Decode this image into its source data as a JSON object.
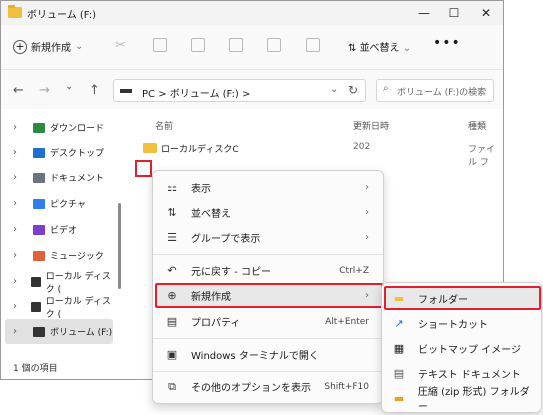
{
  "window": {
    "title": "ボリューム (F:)",
    "minimize": "—",
    "maximize": "☐",
    "close": "✕"
  },
  "toolbar": {
    "new_label": "新規作成",
    "sort_label": "並べ替え",
    "more": "•••"
  },
  "nav": {
    "back": "←",
    "forward": "→",
    "down": "⌄",
    "up": "↑"
  },
  "address": {
    "path": "PC  >  ボリューム (F:)  >",
    "chevron": "⌄",
    "refresh": "↻"
  },
  "search": {
    "placeholder": "ボリューム (F:)の検索"
  },
  "sidebar": {
    "items": [
      {
        "label": "ダウンロード",
        "color": "#2b8a3e"
      },
      {
        "label": "デスクトップ",
        "color": "#1f6fd0"
      },
      {
        "label": "ドキュメント",
        "color": "#6b7280"
      },
      {
        "label": "ピクチャ",
        "color": "#2f80ed"
      },
      {
        "label": "ビデオ",
        "color": "#7b3fd0"
      },
      {
        "label": "ミュージック",
        "color": "#e0603c"
      },
      {
        "label": "ローカル ディスク (",
        "color": "#333333"
      },
      {
        "label": "ローカル ディスク (",
        "color": "#333333"
      },
      {
        "label": "ボリューム (F:)",
        "color": "#333333"
      }
    ]
  },
  "columns": {
    "name": "名前",
    "date": "更新日時",
    "type": "種類"
  },
  "rows": [
    {
      "name": "ローカルディスクC",
      "date": "202",
      "type": "ファイル フ"
    }
  ],
  "status": {
    "count": "1 個の項目"
  },
  "context_menu": {
    "items": [
      {
        "label": "表示",
        "icon": "⚏",
        "sub": "›"
      },
      {
        "label": "並べ替え",
        "icon": "⇅",
        "sub": "›"
      },
      {
        "label": "グループで表示",
        "icon": "☰",
        "sub": "›"
      },
      {
        "label": "元に戻す - コピー",
        "icon": "↶",
        "shortcut": "Ctrl+Z"
      },
      {
        "label": "新規作成",
        "icon": "⊕",
        "sub": "›"
      },
      {
        "label": "プロパティ",
        "icon": "▤",
        "shortcut": "Alt+Enter"
      },
      {
        "label": "Windows ターミナルで開く",
        "icon": "▣"
      },
      {
        "label": "その他のオプションを表示",
        "icon": "⧉",
        "shortcut": "Shift+F10"
      }
    ]
  },
  "submenu": {
    "items": [
      {
        "label": "フォルダー",
        "icon": "▬",
        "color": "#f2c03f"
      },
      {
        "label": "ショートカット",
        "icon": "↗",
        "color": "#1f6fd0"
      },
      {
        "label": "ビットマップ イメージ",
        "icon": "▦",
        "color": "#333333"
      },
      {
        "label": "テキスト ドキュメント",
        "icon": "▤",
        "color": "#555555"
      },
      {
        "label": "圧縮 (zip 形式) フォルダー",
        "icon": "▬",
        "color": "#e0a62a"
      }
    ]
  }
}
